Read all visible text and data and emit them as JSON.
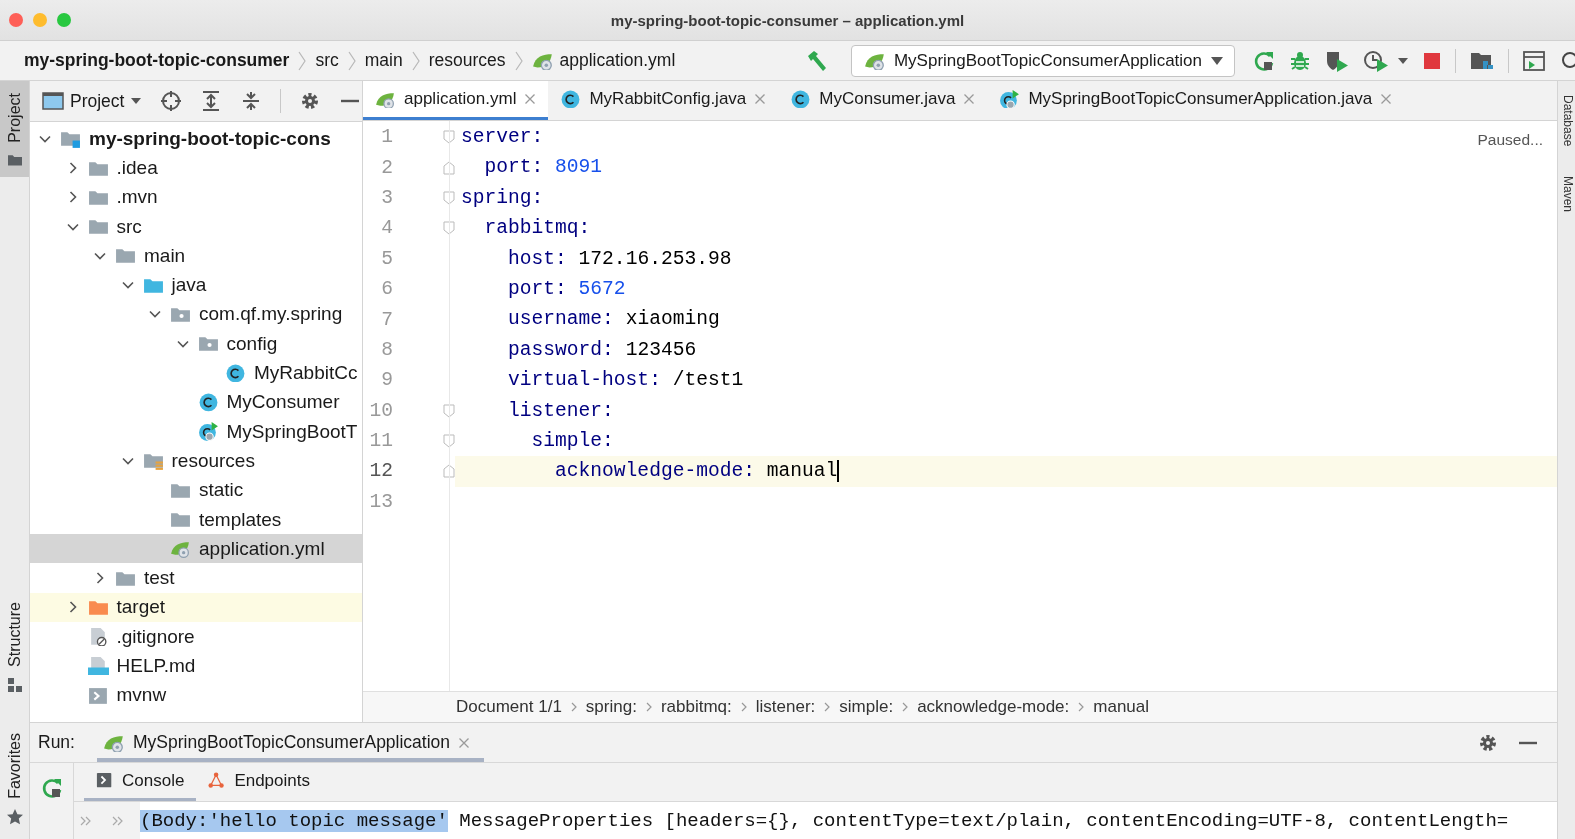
{
  "window": {
    "title": "my-spring-boot-topic-consumer – application.yml"
  },
  "navbar": {
    "breadcrumb": [
      {
        "label": "my-spring-boot-topic-consumer",
        "kind": "project"
      },
      {
        "label": "src",
        "kind": "folder"
      },
      {
        "label": "main",
        "kind": "folder"
      },
      {
        "label": "resources",
        "kind": "folder"
      },
      {
        "label": "application.yml",
        "kind": "yml"
      }
    ],
    "run_config": "MySpringBootTopicConsumerApplication"
  },
  "left_tool_strip": [
    {
      "label": "Project",
      "kind": "project",
      "selected": true
    },
    {
      "label": "Structure",
      "kind": "structure",
      "selected": false
    },
    {
      "label": "Favorites",
      "kind": "favorites",
      "selected": false
    }
  ],
  "project_panel": {
    "title": "Project",
    "tree": [
      {
        "label": "my-spring-boot-topic-cons",
        "kind": "module",
        "expanded": true,
        "selected": false,
        "highlighted": false,
        "children": [
          {
            "label": ".idea",
            "kind": "folder",
            "expanded": false,
            "selected": false,
            "highlighted": false
          },
          {
            "label": ".mvn",
            "kind": "folder",
            "expanded": false,
            "selected": false,
            "highlighted": false
          },
          {
            "label": "src",
            "kind": "folder",
            "expanded": true,
            "selected": false,
            "highlighted": false,
            "children": [
              {
                "label": "main",
                "kind": "folder",
                "expanded": true,
                "selected": false,
                "highlighted": false,
                "children": [
                  {
                    "label": "java",
                    "kind": "source-folder",
                    "expanded": true,
                    "selected": false,
                    "highlighted": false,
                    "children": [
                      {
                        "label": "com.qf.my.spring",
                        "kind": "package",
                        "expanded": true,
                        "selected": false,
                        "highlighted": false,
                        "children": [
                          {
                            "label": "config",
                            "kind": "package",
                            "expanded": true,
                            "selected": false,
                            "highlighted": false,
                            "children": [
                              {
                                "label": "MyRabbitCc",
                                "kind": "class",
                                "selected": false,
                                "highlighted": false
                              }
                            ]
                          },
                          {
                            "label": "MyConsumer",
                            "kind": "class",
                            "selected": false,
                            "highlighted": false
                          },
                          {
                            "label": "MySpringBootT",
                            "kind": "spring-class",
                            "selected": false,
                            "highlighted": false
                          }
                        ]
                      }
                    ]
                  },
                  {
                    "label": "resources",
                    "kind": "resources",
                    "expanded": true,
                    "selected": false,
                    "highlighted": false,
                    "children": [
                      {
                        "label": "static",
                        "kind": "folder",
                        "selected": false,
                        "highlighted": false
                      },
                      {
                        "label": "templates",
                        "kind": "folder",
                        "selected": false,
                        "highlighted": false
                      },
                      {
                        "label": "application.yml",
                        "kind": "yml",
                        "selected": true,
                        "highlighted": false
                      }
                    ]
                  }
                ]
              },
              {
                "label": "test",
                "kind": "folder",
                "expanded": false,
                "selected": false,
                "highlighted": false
              }
            ]
          },
          {
            "label": "target",
            "kind": "excluded-folder",
            "expanded": false,
            "selected": false,
            "highlighted": true
          },
          {
            "label": ".gitignore",
            "kind": "gitignore",
            "selected": false,
            "highlighted": false
          },
          {
            "label": "HELP.md",
            "kind": "markdown",
            "selected": false,
            "highlighted": false
          },
          {
            "label": "mvnw",
            "kind": "script",
            "selected": false,
            "highlighted": false
          }
        ]
      }
    ]
  },
  "editor": {
    "tabs": [
      {
        "label": "application.yml",
        "kind": "yml",
        "selected": true
      },
      {
        "label": "MyRabbitConfig.java",
        "kind": "class",
        "selected": false
      },
      {
        "label": "MyConsumer.java",
        "kind": "class",
        "selected": false
      },
      {
        "label": "MySpringBootTopicConsumerApplication.java",
        "kind": "spring-class",
        "selected": false
      }
    ],
    "status": "Paused...",
    "lines": [
      {
        "number": "1",
        "kind": "opener",
        "key": "server:",
        "current": false
      },
      {
        "number": "2",
        "kind": "closer",
        "key": "  port:",
        "value": "8091",
        "numeric": true,
        "current": false
      },
      {
        "number": "3",
        "kind": "opener",
        "key": "spring:",
        "current": false
      },
      {
        "number": "4",
        "kind": "opener",
        "key": "  rabbitmq:",
        "current": false
      },
      {
        "number": "5",
        "kind": "plain",
        "key": "    host:",
        "value": "172.16.253.98",
        "numeric": false,
        "current": false
      },
      {
        "number": "6",
        "kind": "plain",
        "key": "    port:",
        "value": "5672",
        "numeric": true,
        "current": false
      },
      {
        "number": "7",
        "kind": "plain",
        "key": "    username:",
        "value": "xiaoming",
        "numeric": false,
        "current": false
      },
      {
        "number": "8",
        "kind": "plain",
        "key": "    password:",
        "value": "123456",
        "numeric": false,
        "current": false
      },
      {
        "number": "9",
        "kind": "plain",
        "key": "    virtual-host:",
        "value": "/test1",
        "numeric": false,
        "current": false
      },
      {
        "number": "10",
        "kind": "opener",
        "key": "    listener:",
        "current": false
      },
      {
        "number": "11",
        "kind": "opener",
        "key": "      simple:",
        "current": false
      },
      {
        "number": "12",
        "kind": "closer",
        "key": "        acknowledge-mode:",
        "value": "manual",
        "numeric": false,
        "current": true
      },
      {
        "number": "13",
        "kind": "plain",
        "current": false
      }
    ],
    "breadcrumb": [
      "Document 1/1",
      "spring:",
      "rabbitmq:",
      "listener:",
      "simple:",
      "acknowledge-mode:",
      "manual"
    ]
  },
  "right_tool_strip": [
    {
      "label": "Database"
    },
    {
      "label": "Maven"
    }
  ],
  "run_panel": {
    "label": "Run:",
    "tabs": [
      {
        "label": "MySpringBootTopicConsumerApplication",
        "selected": true
      }
    ],
    "subtabs": [
      {
        "label": "Console",
        "kind": "console",
        "selected": true
      },
      {
        "label": "Endpoints",
        "kind": "endpoints",
        "selected": false
      }
    ],
    "console_lines": [
      {
        "segments": [
          {
            "text": "(Body:'hello topic message'",
            "selected": true
          },
          {
            "text": " MessageProperties [headers={}, contentType=text/plain, contentEncoding=UTF-8, contentLength=",
            "selected": false
          }
        ]
      }
    ]
  }
}
